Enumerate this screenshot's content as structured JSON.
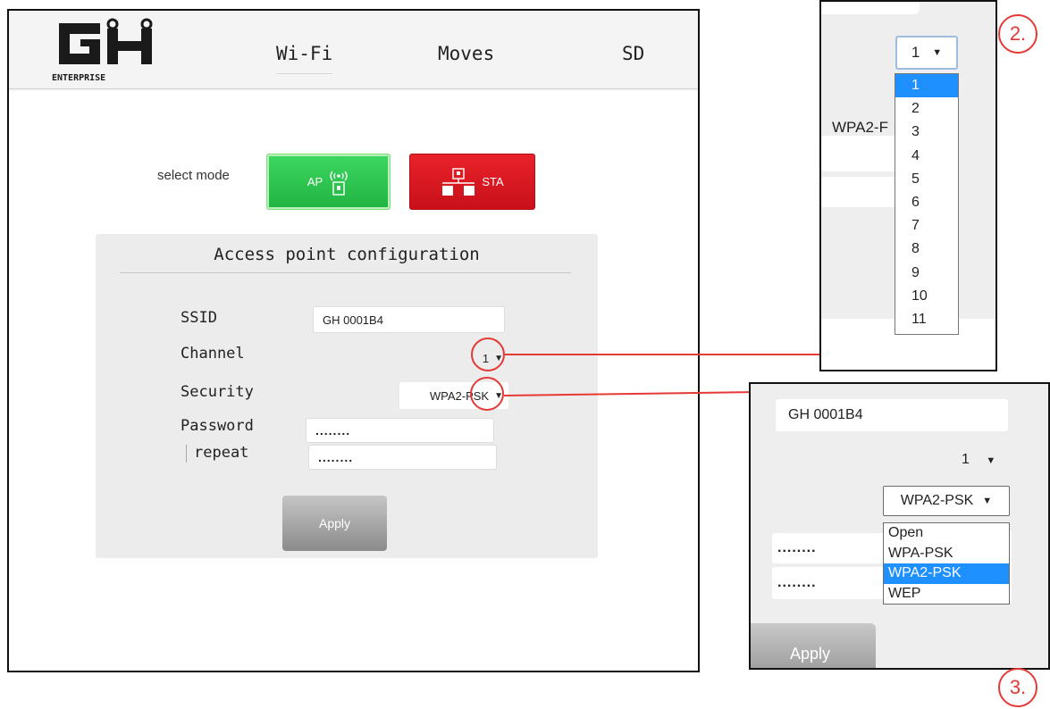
{
  "header": {
    "logo_text": "GH",
    "logo_subtext": "ENTERPRISE",
    "nav": [
      "Wi-Fi",
      "Moves",
      "SD"
    ]
  },
  "mode": {
    "label": "select mode",
    "ap_label": "AP",
    "sta_label": "STA"
  },
  "config": {
    "title": "Access point configuration",
    "ssid_label": "SSID",
    "ssid_value": "GH 0001B4",
    "channel_label": "Channel",
    "channel_value": "1",
    "security_label": "Security",
    "security_value": "WPA2-PSK",
    "password_label": "Password",
    "repeat_label": "repeat",
    "password_mask": "........",
    "repeat_mask": "........",
    "apply_label": "Apply"
  },
  "zoom_channel": {
    "step": "2.",
    "selected": "1",
    "behind_text": "WPA2-F",
    "options": [
      "1",
      "2",
      "3",
      "4",
      "5",
      "6",
      "7",
      "8",
      "9",
      "10",
      "11"
    ],
    "highlighted": "1"
  },
  "zoom_security": {
    "step": "3.",
    "ssid_value": "GH 0001B4",
    "channel_value": "1",
    "selected": "WPA2-PSK",
    "options": [
      "Open",
      "WPA-PSK",
      "WPA2-PSK",
      "WEP"
    ],
    "highlighted": "WPA2-PSK",
    "password_mask": "........",
    "repeat_mask": "........",
    "apply_label": "Apply"
  },
  "colors": {
    "ap_green": "#2ec24f",
    "sta_red": "#d9161e",
    "callout_red": "#e53935",
    "highlight_blue": "#1e90ff"
  }
}
